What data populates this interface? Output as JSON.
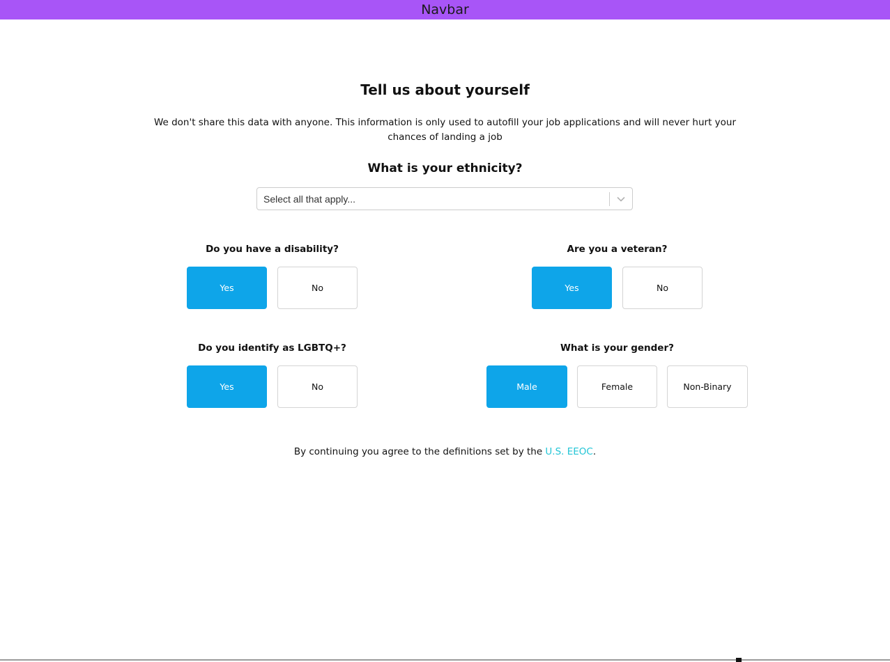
{
  "navbar": {
    "title": "Navbar",
    "color": "#a855f7"
  },
  "header": {
    "title": "Tell us about yourself",
    "subtitle": "We don't share this data with anyone. This information is only used to autofill your job applications and will never hurt your chances of landing a job"
  },
  "ethnicity": {
    "question": "What is your ethnicity?",
    "placeholder": "Select all that apply...",
    "chevron_icon": "chevron-down-icon"
  },
  "disability": {
    "question": "Do you have a disability?",
    "options": [
      "Yes",
      "No"
    ],
    "selected": "Yes"
  },
  "veteran": {
    "question": "Are you a veteran?",
    "options": [
      "Yes",
      "No"
    ],
    "selected": "Yes"
  },
  "lgbtq": {
    "question": "Do you identify as LGBTQ+?",
    "options": [
      "Yes",
      "No"
    ],
    "selected": "Yes"
  },
  "gender": {
    "question": "What is your gender?",
    "options": [
      "Male",
      "Female",
      "Non-Binary"
    ],
    "selected": "Male"
  },
  "footer": {
    "text_before": "By continuing you agree to the definitions set by the ",
    "link_text": "U.S. EEOC",
    "text_after": "."
  },
  "colors": {
    "selected": "#0ea5e9",
    "link": "#22c5d6"
  }
}
